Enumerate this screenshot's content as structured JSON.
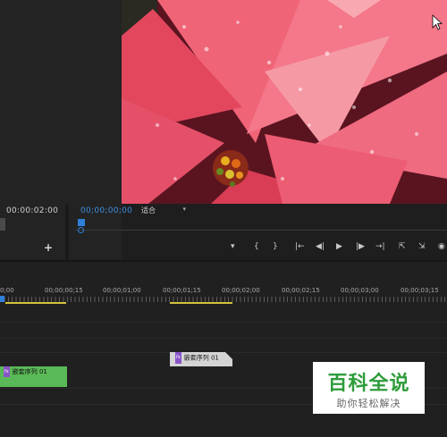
{
  "source_panel": {
    "timecode": "00:00:02:00",
    "add_label": "+"
  },
  "program_monitor": {
    "timecode": "00;00;00;00",
    "fit_dropdown": "适合",
    "video_description": "pink poinsettia leaves with water droplets",
    "transport_icons": [
      "add-marker-icon",
      "mark-in-icon",
      "mark-out-icon",
      "go-to-in-icon",
      "step-back-icon",
      "play-icon",
      "step-forward-icon",
      "go-to-out-icon",
      "lift-icon",
      "extract-icon",
      "export-frame-icon"
    ],
    "transport_glyphs": [
      "▾",
      "{",
      "}",
      "|←",
      "◀|",
      "▶",
      "|▶",
      "→|",
      "⇱",
      "⇲",
      "◉"
    ]
  },
  "timeline": {
    "ruler": [
      "0;00",
      "00;00;00;15",
      "00;00;01;00",
      "00;00;01;15",
      "00;00;02;00",
      "00;00;02;15",
      "00;00;03;00",
      "00;00;03;15"
    ],
    "clip_upper": {
      "fx": "fx",
      "label": "嵌套序列 01"
    },
    "clip_lower": {
      "fx": "fx",
      "label": "嵌套序列 01"
    }
  },
  "watermark": {
    "title": "百科全说",
    "subtitle": "助你轻松解决"
  },
  "colors": {
    "accent_blue": "#2d7fd8",
    "clip_green": "#5ab957",
    "inout_yellow": "#d6c13d",
    "brand_green": "#2e9c3b"
  }
}
